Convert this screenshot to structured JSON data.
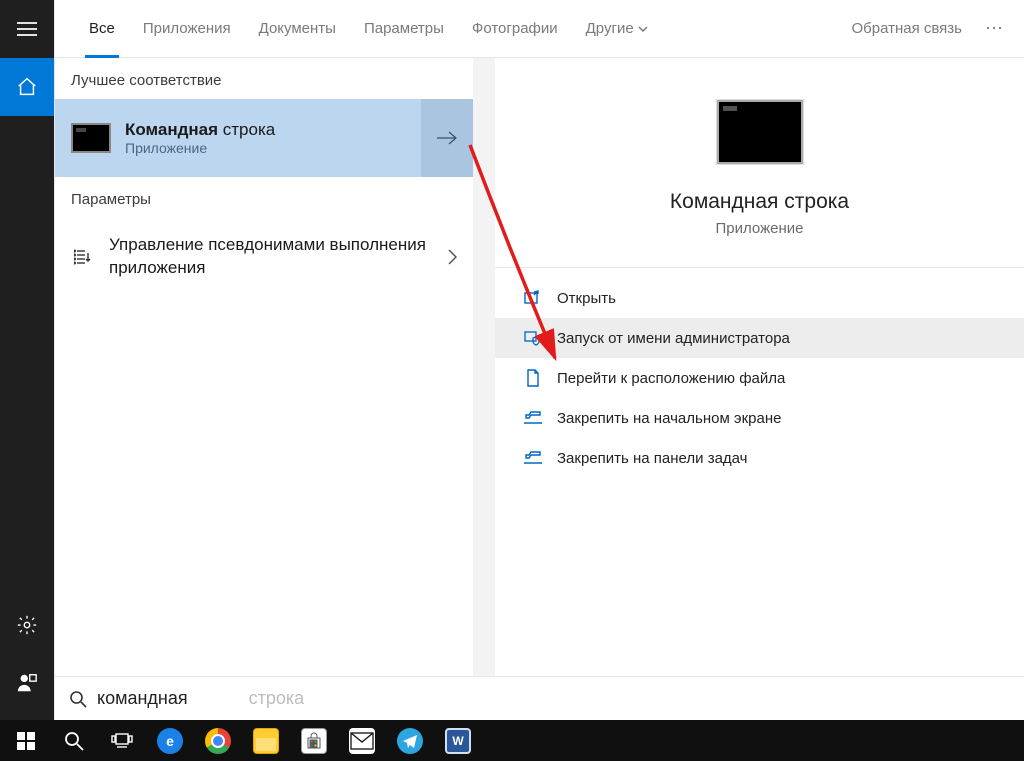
{
  "tabs": {
    "all": "Все",
    "apps": "Приложения",
    "docs": "Документы",
    "settings": "Параметры",
    "photos": "Фотографии",
    "more": "Другие"
  },
  "feedback_label": "Обратная связь",
  "left": {
    "best_header": "Лучшее соответствие",
    "best_title_bold": "Командная",
    "best_title_rest": " строка",
    "best_sub": "Приложение",
    "settings_header": "Параметры",
    "setting_item": "Управление псевдонимами выполнения приложения"
  },
  "detail": {
    "title": "Командная строка",
    "sub": "Приложение",
    "actions": [
      "Открыть",
      "Запуск от имени администратора",
      "Перейти к расположению файла",
      "Закрепить на начальном экране",
      "Закрепить на панели задач"
    ]
  },
  "search": {
    "typed": "командная",
    "suggestion_rest": " строка"
  },
  "icons": {
    "hamburger": "hamburger-icon",
    "home": "home-icon",
    "gear": "gear-icon",
    "account": "account-icon",
    "start": "start-icon",
    "search": "search-icon",
    "taskview": "taskview-icon"
  }
}
